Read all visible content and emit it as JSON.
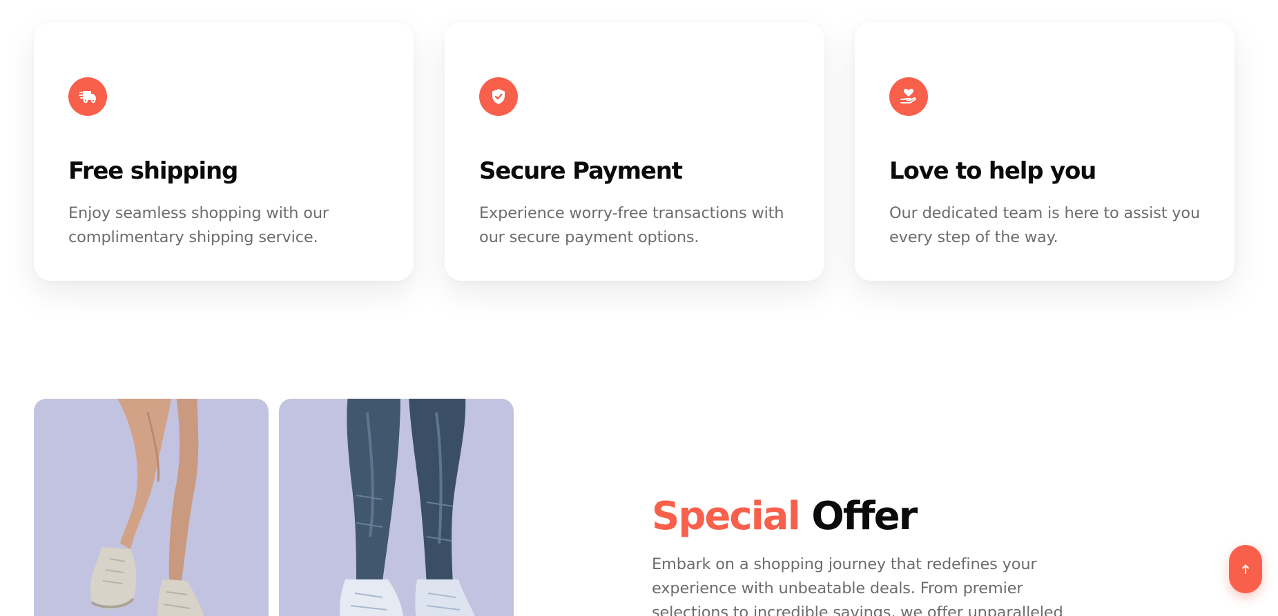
{
  "features": [
    {
      "icon": "delivery-truck-icon",
      "title": "Free shipping",
      "description": "Enjoy seamless shopping with our complimentary shipping service."
    },
    {
      "icon": "shield-check-icon",
      "title": "Secure Payment",
      "description": "Experience worry-free transactions with our secure payment options."
    },
    {
      "icon": "hand-heart-icon",
      "title": "Love to help you",
      "description": "Our dedicated team is here to assist you every step of the way."
    }
  ],
  "special_offer": {
    "title_accent": "Special",
    "title_rest": "Offer",
    "description": "Embark on a shopping journey that redefines your experience with unbeatable deals. From premier selections to incredible savings, we offer unparalleled"
  },
  "scroll_top": {
    "icon": "arrow-up-icon"
  },
  "colors": {
    "accent": "#f8604c",
    "photo_background": "#c2c3e0",
    "heading": "#0b0b0b",
    "body_text": "#6d6d6d"
  }
}
